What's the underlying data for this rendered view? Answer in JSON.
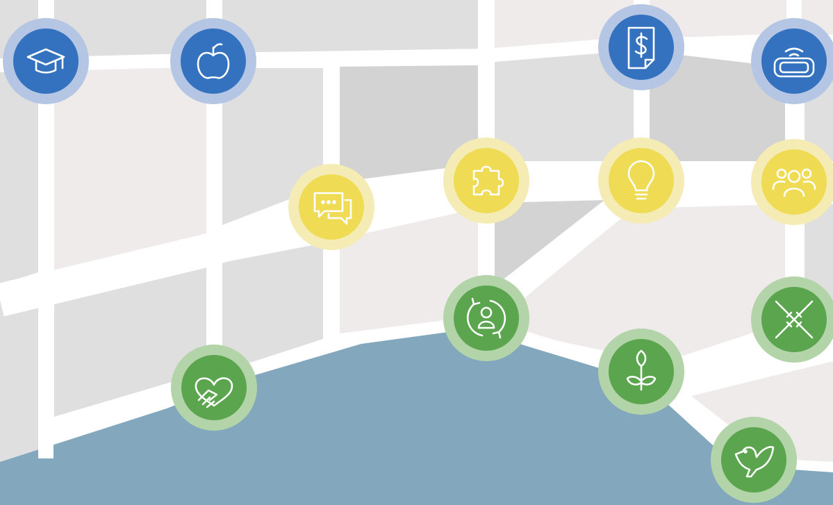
{
  "colors": {
    "background": "#ffffff",
    "block_light": "#efebea",
    "block_mid": "#e0dfe0",
    "block_dark": "#d3d3d4",
    "road": "#ffffff",
    "water": "#83a8be",
    "blue_ring": "#b5c6e5",
    "blue_fill": "#3472bf",
    "yellow_ring": "#f4ecb4",
    "yellow_fill": "#f0db55",
    "green_ring": "#b3d4a9",
    "green_fill": "#5aa54d",
    "icon_stroke": "#ffffff"
  },
  "markers": [
    {
      "id": "graduation-cap",
      "icon": "graduation-cap-icon",
      "category": "blue"
    },
    {
      "id": "apple",
      "icon": "apple-icon",
      "category": "blue"
    },
    {
      "id": "invoice-dollar",
      "icon": "invoice-dollar-icon",
      "category": "blue"
    },
    {
      "id": "vr-headset",
      "icon": "vr-headset-icon",
      "category": "blue"
    },
    {
      "id": "chat",
      "icon": "chat-bubbles-icon",
      "category": "yellow"
    },
    {
      "id": "puzzle",
      "icon": "puzzle-piece-icon",
      "category": "yellow"
    },
    {
      "id": "lightbulb",
      "icon": "lightbulb-icon",
      "category": "yellow"
    },
    {
      "id": "team",
      "icon": "team-people-icon",
      "category": "yellow"
    },
    {
      "id": "heart-hand",
      "icon": "heart-hand-icon",
      "category": "green"
    },
    {
      "id": "person-cycle",
      "icon": "person-cycle-icon",
      "category": "green"
    },
    {
      "id": "sprout",
      "icon": "sprout-icon",
      "category": "green"
    },
    {
      "id": "joined-hands",
      "icon": "joined-hands-icon",
      "category": "green"
    },
    {
      "id": "dove",
      "icon": "dove-icon",
      "category": "green"
    }
  ]
}
